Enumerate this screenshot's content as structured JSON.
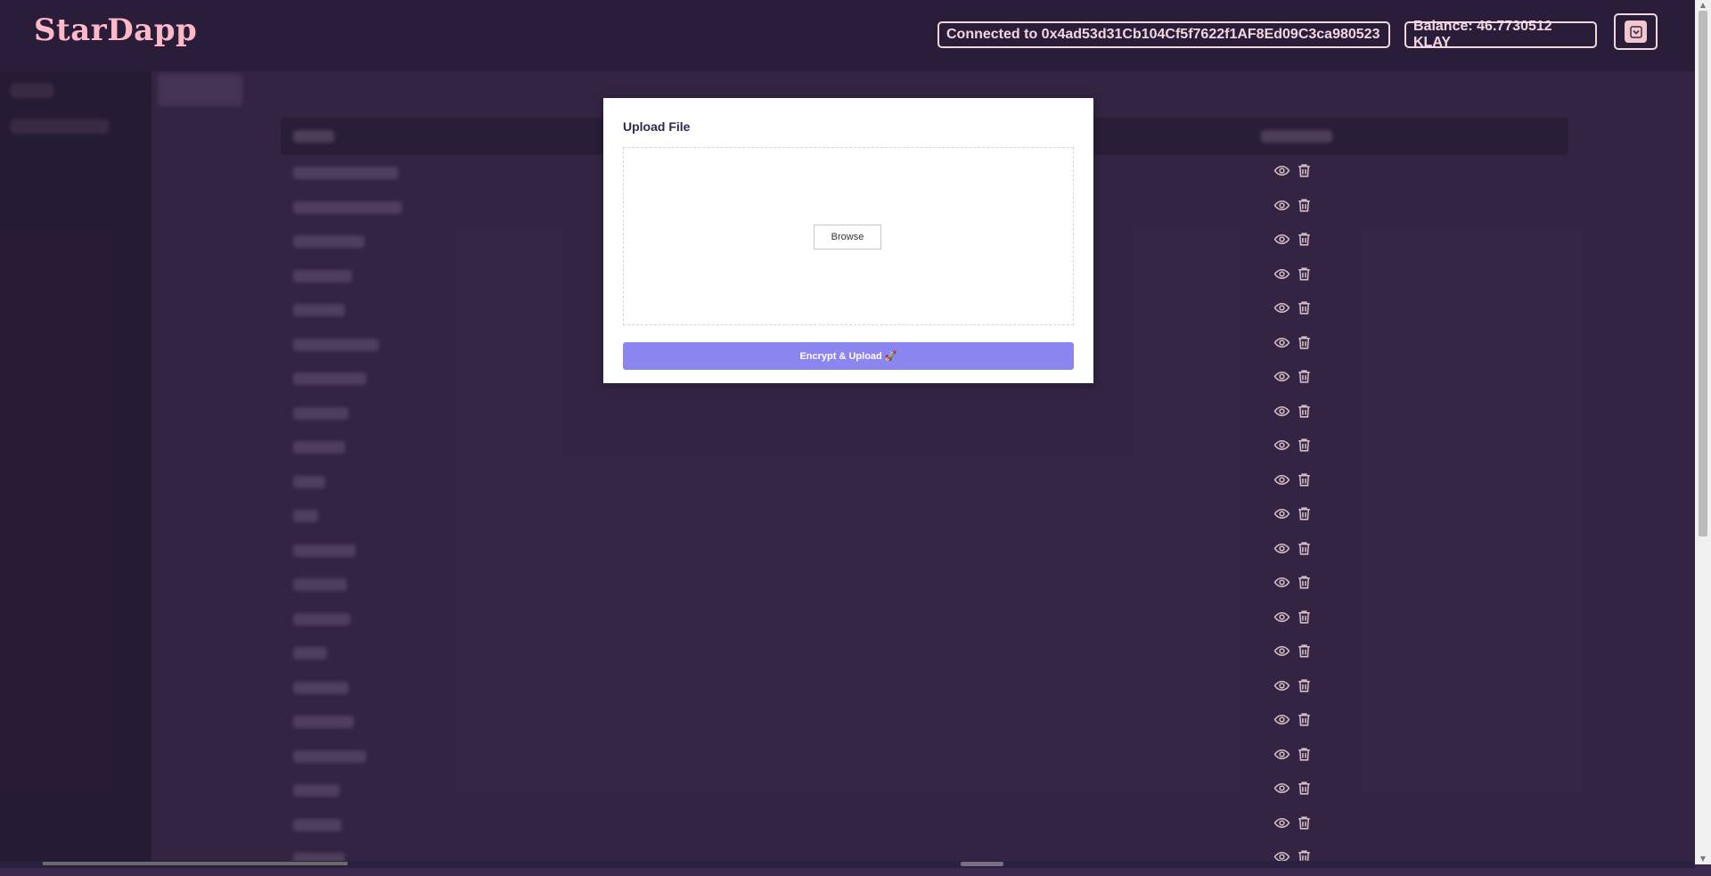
{
  "header": {
    "logo": "StarDapp",
    "connected_label": "Connected to 0x4ad53d31Cb104Cf5f7622f1AF8Ed09C3ca980523",
    "balance_label": "Balance: 46.7730512 KLAY",
    "wallet_icon": "chevron-down-icon"
  },
  "colors": {
    "header_bg": "#2a1d39",
    "page_bg": "#3b2a4d",
    "accent_pink": "#ffb8c8",
    "upload_button": "#8b86ef"
  },
  "modal": {
    "title": "Upload File",
    "browse_label": "Browse",
    "upload_label": "Encrypt & Upload 🚀"
  },
  "table": {
    "row_actions": [
      "eye-icon",
      "trash-icon"
    ]
  }
}
